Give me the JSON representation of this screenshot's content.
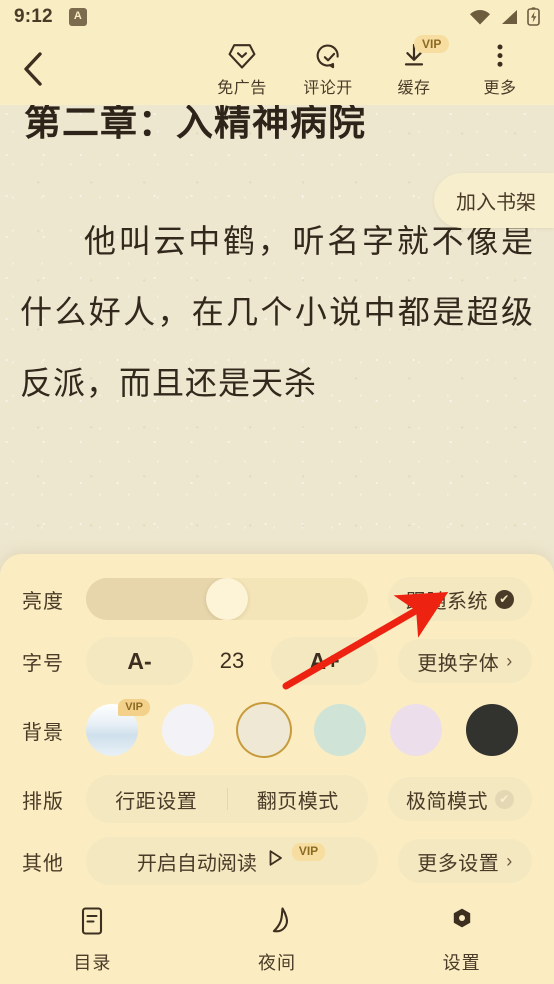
{
  "status_bar": {
    "time": "9:12",
    "app_badge": "A",
    "icons": [
      "wifi-icon",
      "signal-icon",
      "battery-charging-icon"
    ]
  },
  "toolbar": {
    "back_icon": "chevron-left-icon",
    "actions": [
      {
        "label": "免广告",
        "icon": "gem-icon",
        "vip": false
      },
      {
        "label": "评论开",
        "icon": "comment-check-icon",
        "vip": false
      },
      {
        "label": "缓存",
        "icon": "download-icon",
        "vip": true,
        "vip_label": "VIP"
      },
      {
        "label": "更多",
        "icon": "more-vertical-icon",
        "vip": false
      }
    ]
  },
  "reader": {
    "chapter_title": "第二章：入精神病院",
    "add_bookshelf_label": "加入书架",
    "body_text": "他叫云中鹤，听名字就不像是什么好人，在几个小说中都是超级反派，而且还是天杀"
  },
  "settings": {
    "brightness": {
      "label": "亮度",
      "value_percent": 50,
      "follow_system_label": "跟随系统",
      "follow_system_on": true
    },
    "font_size": {
      "label": "字号",
      "decrease_label": "A-",
      "value": "23",
      "increase_label": "A+",
      "change_font_label": "更换字体",
      "chevron": "›"
    },
    "background": {
      "label": "背景",
      "swatches": [
        {
          "name": "sky-image",
          "color": "#dbe8f1",
          "vip": true,
          "vip_label": "VIP",
          "selected": false
        },
        {
          "name": "white",
          "color": "#f3f2f6",
          "vip": false,
          "selected": false
        },
        {
          "name": "cream",
          "color": "#efe8d4",
          "vip": false,
          "selected": true
        },
        {
          "name": "mint",
          "color": "#cfe3d6",
          "vip": false,
          "selected": false
        },
        {
          "name": "pink",
          "color": "#ecdeea",
          "vip": false,
          "selected": false
        },
        {
          "name": "dark",
          "color": "#32322f",
          "vip": false,
          "selected": false
        }
      ]
    },
    "layout": {
      "label": "排版",
      "line_spacing_label": "行距设置",
      "page_mode_label": "翻页模式",
      "minimal_mode_label": "极简模式",
      "minimal_mode_on": false
    },
    "other": {
      "label": "其他",
      "auto_read_label": "开启自动阅读",
      "auto_read_icon": "play-icon",
      "auto_read_vip": "VIP",
      "more_settings_label": "更多设置",
      "chevron": "›"
    }
  },
  "bottom_nav": [
    {
      "label": "目录",
      "icon": "contents-icon"
    },
    {
      "label": "夜间",
      "icon": "moon-icon"
    },
    {
      "label": "设置",
      "icon": "gear-icon"
    }
  ],
  "annotation": {
    "arrow_color": "#ee2211",
    "points_to": "更换字体"
  },
  "colors": {
    "page_bg": "#f9edc4",
    "panel_bg": "#fbedc1",
    "paper_bg": "#eee7cf",
    "text": "#3d2f1f",
    "vip_badge_bg": "#f7dea0",
    "selected_ring": "#c79b3c"
  }
}
